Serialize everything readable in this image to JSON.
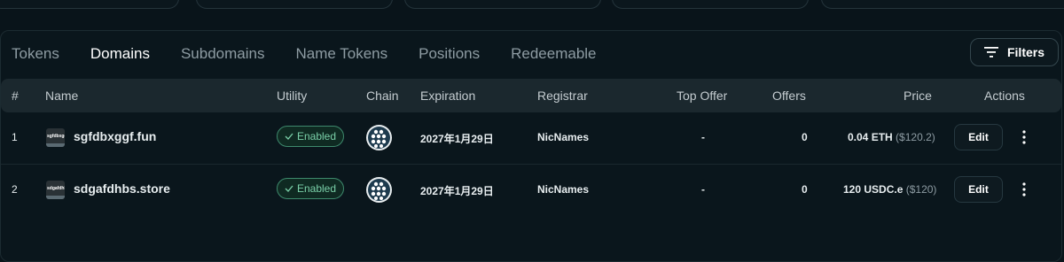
{
  "tabs": [
    {
      "label": "Tokens",
      "active": false
    },
    {
      "label": "Domains",
      "active": true
    },
    {
      "label": "Subdomains",
      "active": false
    },
    {
      "label": "Name Tokens",
      "active": false
    },
    {
      "label": "Positions",
      "active": false
    },
    {
      "label": "Redeemable",
      "active": false
    }
  ],
  "filters_label": "Filters",
  "columns": {
    "index": "#",
    "name": "Name",
    "utility": "Utility",
    "chain": "Chain",
    "expiration": "Expiration",
    "registrar": "Registrar",
    "top_offer": "Top Offer",
    "offers": "Offers",
    "price": "Price",
    "actions": "Actions"
  },
  "rows": [
    {
      "index": "1",
      "thumb_text": "sgfdbxgg",
      "name": "sgfdbxggf.fun",
      "utility": "Enabled",
      "chain_icon": "chain-logo-icon",
      "expiration": "2027年1月29日",
      "registrar": "NicNames",
      "top_offer": "-",
      "offers": "0",
      "price": "0.04 ETH",
      "price_usd": "($120.2)",
      "edit_label": "Edit"
    },
    {
      "index": "2",
      "thumb_text": "sdgafdhbs",
      "name": "sdgafdhbs.store",
      "utility": "Enabled",
      "chain_icon": "chain-logo-icon",
      "expiration": "2027年1月29日",
      "registrar": "NicNames",
      "top_offer": "-",
      "offers": "0",
      "price": "120 USDC.e",
      "price_usd": "($120)",
      "edit_label": "Edit"
    }
  ],
  "colors": {
    "background": "#09141a",
    "enabled_badge": "#7ad0a8",
    "header_row": "#1b282e"
  }
}
